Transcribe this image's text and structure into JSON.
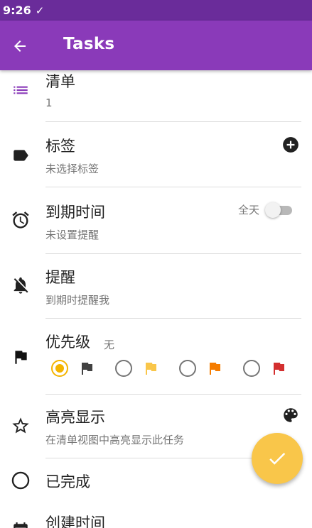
{
  "status_bar": {
    "time": "9:26",
    "check": "✓"
  },
  "app_bar": {
    "title": "Tasks",
    "back_icon": "arrow-left-icon"
  },
  "rows": {
    "list": {
      "title": "清单",
      "value": "1",
      "icon": "list-icon"
    },
    "tags": {
      "title": "标签",
      "value": "未选择标签",
      "icon": "label-icon",
      "action_icon": "add-circle-icon"
    },
    "due": {
      "title": "到期时间",
      "value": "未设置提醒",
      "icon": "alarm-clock-icon",
      "allday_label": "全天",
      "allday_on": false
    },
    "reminder": {
      "title": "提醒",
      "value": "到期时提醒我",
      "icon": "bell-off-icon"
    },
    "priority": {
      "title": "优先级",
      "value": "无",
      "icon": "flag-icon",
      "options": [
        {
          "color": "#424242",
          "selected": true
        },
        {
          "color": "#f9c64a",
          "selected": false
        },
        {
          "color": "#f57c00",
          "selected": false
        },
        {
          "color": "#d32f2f",
          "selected": false
        }
      ]
    },
    "highlight": {
      "title": "高亮显示",
      "value": "在清单视图中高亮显示此任务",
      "icon": "star-outline-icon",
      "action_icon": "palette-icon"
    },
    "completed": {
      "title": "已完成",
      "icon": "circle-outline-icon"
    },
    "created": {
      "title": "创建时间",
      "icon": "calendar-icon"
    }
  },
  "colors": {
    "primary": "#8a3ab9",
    "status_bar": "#6a2c9a",
    "accent": "#f9c64a",
    "list_icon": "#8a3ab9"
  }
}
